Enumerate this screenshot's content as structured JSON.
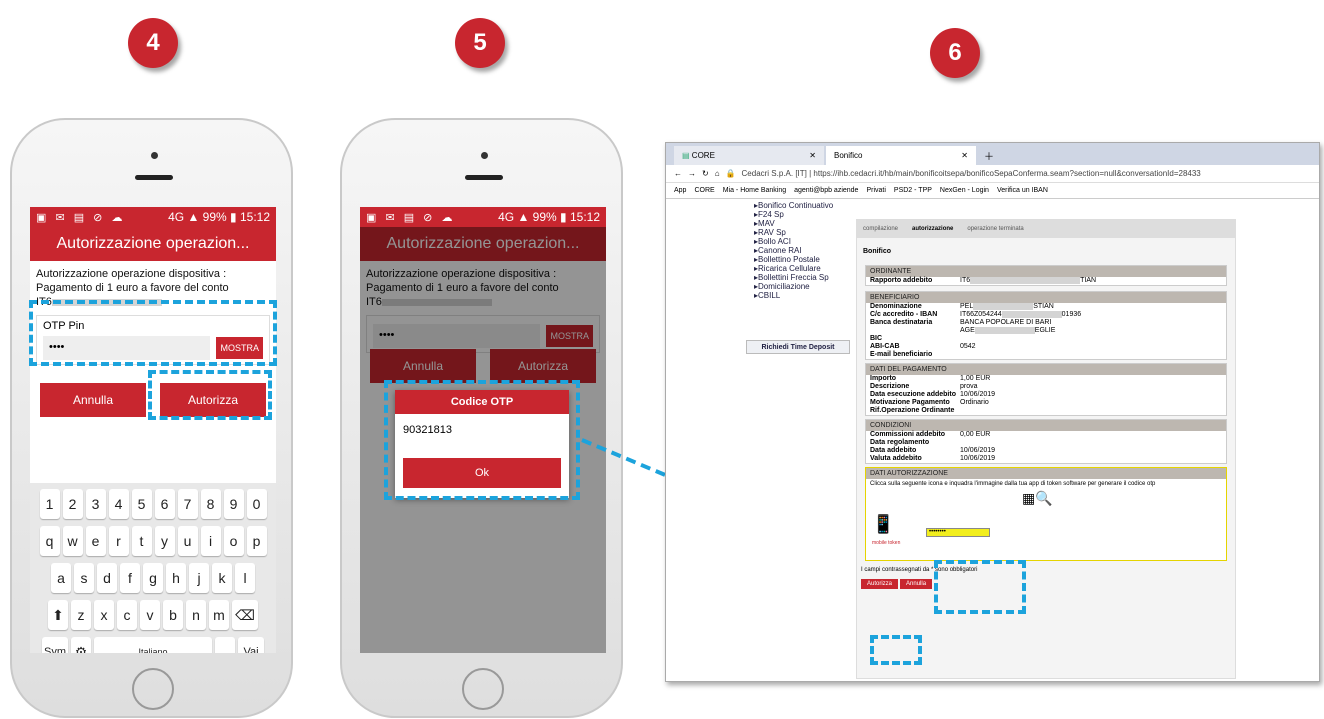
{
  "steps": [
    "4",
    "5",
    "6"
  ],
  "phone1": {
    "status_time": "15:12",
    "status_battery": "99%",
    "status_signal": "4G",
    "title": "Autorizzazione operazion...",
    "description": "Autorizzazione operazione dispositiva : Pagamento di 1 euro a favore del conto",
    "iban_prefix": "IT6",
    "otp_label": "OTP Pin",
    "otp_value": "••••",
    "show_label": "MOSTRA",
    "cancel": "Annulla",
    "authorize": "Autorizza",
    "kb_row1": [
      "1",
      "2",
      "3",
      "4",
      "5",
      "6",
      "7",
      "8",
      "9",
      "0"
    ],
    "kb_row2": [
      "q",
      "w",
      "e",
      "r",
      "t",
      "y",
      "u",
      "i",
      "o",
      "p"
    ],
    "kb_row3": [
      "a",
      "s",
      "d",
      "f",
      "g",
      "h",
      "j",
      "k",
      "l"
    ],
    "kb_row4": [
      "z",
      "x",
      "c",
      "v",
      "b",
      "n",
      "m"
    ],
    "kb_sym": "Sym",
    "kb_lang": "Italiano",
    "kb_go": "Vai"
  },
  "phone2": {
    "status_time": "15:12",
    "status_battery": "99%",
    "status_signal": "4G",
    "title": "Autorizzazione operazion...",
    "description": "Autorizzazione operazione dispositiva : Pagamento di 1 euro a favore del conto",
    "iban_prefix": "IT6",
    "otp_value": "••••",
    "show_label": "MOSTRA",
    "cancel": "Annulla",
    "authorize": "Autorizza",
    "dialog_title": "Codice OTP",
    "dialog_code": "90321813",
    "dialog_ok": "Ok"
  },
  "browser": {
    "tab1": "CORE",
    "tab2": "Bonifico",
    "url": "Cedacri S.p.A. [IT] | https://ihb.cedacri.it/hb/main/bonificoitsepa/bonificoSepaConferma.seam?section=null&conversationId=28433",
    "bookmarks": [
      "App",
      "CORE",
      "Mia - Home Banking",
      "agenti@bpb aziende",
      "Privati",
      "PSD2 - TPP",
      "NexGen - Login",
      "Verifica un IBAN"
    ],
    "sidebar": [
      "Bonifico Continuativo",
      "F24 Sp",
      "MAV",
      "RAV Sp",
      "Bollo ACI",
      "Canone RAI",
      "Bollettino Postale",
      "Ricarica Cellulare",
      "Bollettini Freccia Sp",
      "Domiciliazione",
      "CBILL"
    ],
    "time_deposit": "Richiedi Time Deposit",
    "steps": [
      "compilazione",
      "autorizzazione",
      "operazione terminata"
    ],
    "page_title": "Bonifico",
    "ordinante_h": "ORDINANTE",
    "rapporto_k": "Rapporto addebito",
    "rapporto_v1": "IT6",
    "rapporto_v2": "TIAN",
    "benef_h": "BENEFICIARIO",
    "benef_rows": [
      [
        "Denominazione",
        "PEL",
        "STIAN"
      ],
      [
        "C/c accredito - IBAN",
        "IT66Z054244",
        "01936"
      ],
      [
        "Banca destinataria",
        "BANCA POPOLARE DI BARI",
        ""
      ],
      [
        "",
        "AGE",
        "EGLIE"
      ],
      [
        "BIC",
        "",
        ""
      ],
      [
        "ABI-CAB",
        "0542",
        ""
      ],
      [
        "E-mail beneficiario",
        "",
        ""
      ]
    ],
    "pag_h": "DATI DEL PAGAMENTO",
    "pag_rows": [
      [
        "Importo",
        "1,00 EUR"
      ],
      [
        "Descrizione",
        "prova"
      ],
      [
        "Data esecuzione addebito",
        "10/06/2019"
      ],
      [
        "Motivazione Pagamento",
        "Ordinario"
      ],
      [
        "Rif.Operazione Ordinante",
        ""
      ]
    ],
    "cond_h": "CONDIZIONI",
    "cond_rows": [
      [
        "Commissioni addebito",
        "0,00 EUR"
      ],
      [
        "Data regolamento",
        ""
      ],
      [
        "Data addebito",
        "10/06/2019"
      ],
      [
        "Valuta addebito",
        "10/06/2019"
      ]
    ],
    "auth_h": "DATI AUTORIZZAZIONE",
    "auth_text": "Clicca sulla seguente icona e inquadra l'immagine dalla tua app di token software per generare il codice otp",
    "mobile_label": "mobile token",
    "pin_value": "••••••••",
    "required_note": "I campi contrassegnati da * sono obbligatori",
    "authorize": "Autorizza",
    "cancel": "Annulla"
  },
  "colors": {
    "brand": "#c8262f",
    "callout": "#1ca3dc"
  }
}
